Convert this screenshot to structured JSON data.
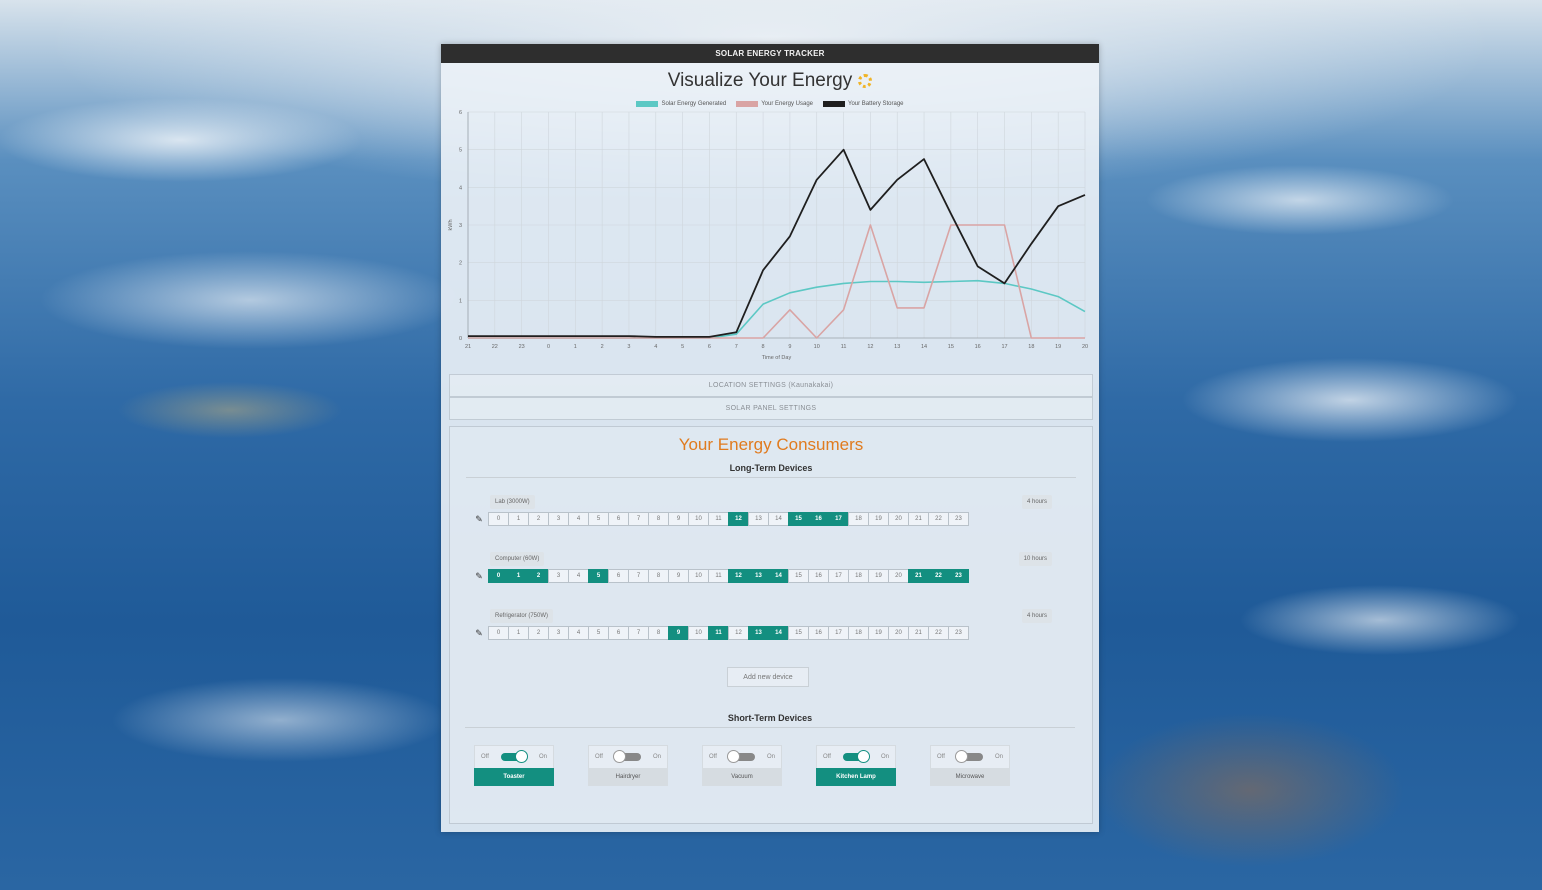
{
  "app": {
    "title": "SOLAR ENERGY TRACKER"
  },
  "headline": "Visualize Your Energy",
  "chart_data": {
    "type": "line",
    "x": [
      "21",
      "22",
      "23",
      "0",
      "1",
      "2",
      "3",
      "4",
      "5",
      "6",
      "7",
      "8",
      "9",
      "10",
      "11",
      "12",
      "13",
      "14",
      "15",
      "16",
      "17",
      "18",
      "19",
      "20"
    ],
    "series": [
      {
        "name": "Solar Energy Generated",
        "color": "#5cc8c4",
        "values": [
          0,
          0,
          0,
          0,
          0,
          0,
          0,
          0,
          0,
          0,
          0.1,
          0.9,
          1.2,
          1.35,
          1.45,
          1.5,
          1.5,
          1.48,
          1.5,
          1.52,
          1.45,
          1.3,
          1.1,
          0.7
        ]
      },
      {
        "name": "Your Energy Usage",
        "color": "#d9a4a4",
        "values": [
          0,
          0,
          0,
          0,
          0,
          0,
          0,
          0,
          0,
          0,
          0,
          0,
          0.75,
          0,
          0.75,
          3,
          0.8,
          0.8,
          3,
          3,
          3,
          0,
          0,
          0
        ]
      },
      {
        "name": "Your Battery Storage",
        "color": "#1f1f1f",
        "values": [
          0.05,
          0.05,
          0.05,
          0.05,
          0.05,
          0.05,
          0.05,
          0.03,
          0.03,
          0.03,
          0.15,
          1.8,
          2.7,
          4.2,
          5,
          3.4,
          4.2,
          4.75,
          3.3,
          1.9,
          1.45,
          2.5,
          3.5,
          3.8
        ]
      }
    ],
    "ylim": [
      0,
      6
    ],
    "yticks": [
      "0",
      "1",
      "2",
      "3",
      "4",
      "5",
      "6"
    ],
    "xlabel": "Time of Day",
    "ylabel": "kWh",
    "grid": true,
    "legend": "top"
  },
  "accordions": {
    "location": "LOCATION SETTINGS (Kaunakakai)",
    "solar_panel": "SOLAR PANEL SETTINGS"
  },
  "consumers": {
    "title": "Your Energy Consumers",
    "long_term_title": "Long-Term Devices",
    "edit_icon": "✎",
    "hour_labels": [
      "0",
      "1",
      "2",
      "3",
      "4",
      "5",
      "6",
      "7",
      "8",
      "9",
      "10",
      "11",
      "12",
      "13",
      "14",
      "15",
      "16",
      "17",
      "18",
      "19",
      "20",
      "21",
      "22",
      "23"
    ],
    "devices": [
      {
        "name": "Lab (3000W)",
        "hours_label": "4 hours",
        "active_hours": [
          12,
          15,
          16,
          17
        ]
      },
      {
        "name": "Computer (60W)",
        "hours_label": "10 hours",
        "active_hours": [
          0,
          1,
          2,
          5,
          12,
          13,
          14,
          21,
          22,
          23
        ]
      },
      {
        "name": "Refrigerator (750W)",
        "hours_label": "4 hours",
        "active_hours": [
          9,
          11,
          13,
          14
        ]
      }
    ],
    "add_button": "Add new device",
    "short_term_title": "Short-Term Devices",
    "toggle_off": "Off",
    "toggle_on": "On",
    "short_devices": [
      {
        "name": "Toaster",
        "on": true
      },
      {
        "name": "Hairdryer",
        "on": false
      },
      {
        "name": "Vacuum",
        "on": false
      },
      {
        "name": "Kitchen Lamp",
        "on": true
      },
      {
        "name": "Microwave",
        "on": false
      }
    ]
  },
  "colors": {
    "accent": "#138f80",
    "title_orange": "#e07b1f",
    "topbar": "#2e2e2e"
  }
}
